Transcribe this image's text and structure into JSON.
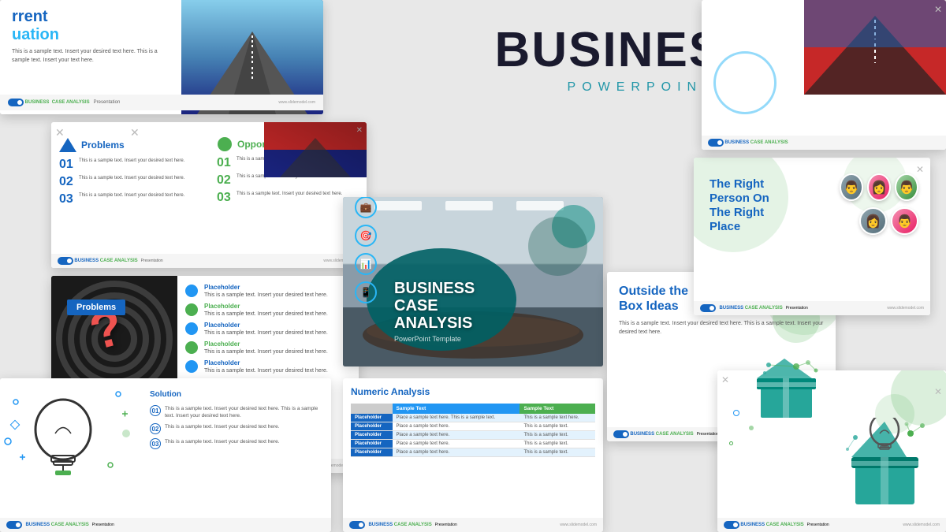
{
  "page": {
    "background": "#e8e8e8",
    "title": "BUSINESS CASE",
    "subtitle": "POWERPOINT TEMPLATE"
  },
  "slides": {
    "topleft": {
      "heading1": "rrent",
      "heading2": "uation",
      "heading_color": "#1565c0",
      "para": "This is a sample text. Insert your desired text here. This is a sample text. Insert your text here.",
      "footer_label": "BUSINESS",
      "footer_sub": "CASE ANALYSIS",
      "footer_type": "Presentation"
    },
    "midleft": {
      "col1_title": "Problems",
      "col2_title": "Opportunity",
      "col1_items": [
        {
          "num": "01",
          "text": "This is a sample text. Insert your desired text here."
        },
        {
          "num": "02",
          "text": "This is a sample text. Insert your desired text here."
        },
        {
          "num": "03",
          "text": "This is a sample text. Insert your desired text here."
        }
      ],
      "col2_items": [
        {
          "num": "01",
          "text": "This is a sample text. Insert your desired text here."
        },
        {
          "num": "02",
          "text": "This is a sample text. Insert your desired text here."
        },
        {
          "num": "03",
          "text": "This is a sample text. Insert your desired text here."
        }
      ]
    },
    "problems": {
      "label": "Problems",
      "placeholders": [
        {
          "title": "Placeholder",
          "text": "This is a sample text. Insert your desired text here."
        },
        {
          "title": "Placeholder",
          "text": "This is a sample text. Insert your desired text here."
        },
        {
          "title": "Placeholder",
          "text": "This is a sample text. Insert your desired text here."
        },
        {
          "title": "Placeholder",
          "text": "This is a sample text. Insert your desired text here."
        },
        {
          "title": "Placeholder",
          "text": "This is a sample text. Insert your desired text here."
        }
      ]
    },
    "solution": {
      "title": "olution",
      "items": [
        {
          "num": "01",
          "text": "This is a sample text. Insert your desired text here. This is a sample text. Insert your desired text here."
        },
        {
          "num": "02",
          "text": "This is a sample text. Insert your desired text here."
        },
        {
          "num": "03",
          "text": "This is a sample text. Insert your desired text here."
        }
      ]
    },
    "center_main": {
      "title": "BUSINESS\nCASE\nANALYSIS",
      "subtitle": "PowerPoint Template"
    },
    "numeric": {
      "title": "Numeric Analysis",
      "col1_header": "Sample Text",
      "col2_header": "Sample Text",
      "rows": [
        {
          "label": "Placeholder",
          "col1": "Place a sample text here. This is a sample text.",
          "col2": "This is a sample text here."
        },
        {
          "label": "Placeholder",
          "col1": "Place a sample text here.",
          "col2": "This is a sample text here."
        },
        {
          "label": "Placeholder",
          "col1": "Place a sample text here.",
          "col2": "This is a sample text here."
        },
        {
          "label": "Placeholder",
          "col1": "Place a sample text here.",
          "col2": "This is a sample text here."
        },
        {
          "label": "Placeholder",
          "col1": "Place a sample text here.",
          "col2": "This is a sample text here."
        }
      ]
    },
    "outside_box": {
      "title_line1": "Outside the",
      "title_line2": "Box Ideas",
      "text": "This is a sample text. Insert your desired text here. This is a sample text. Insert your desired text here."
    },
    "right_person": {
      "title": "The Right\nPerson On\nThe Right\nPlace"
    }
  }
}
